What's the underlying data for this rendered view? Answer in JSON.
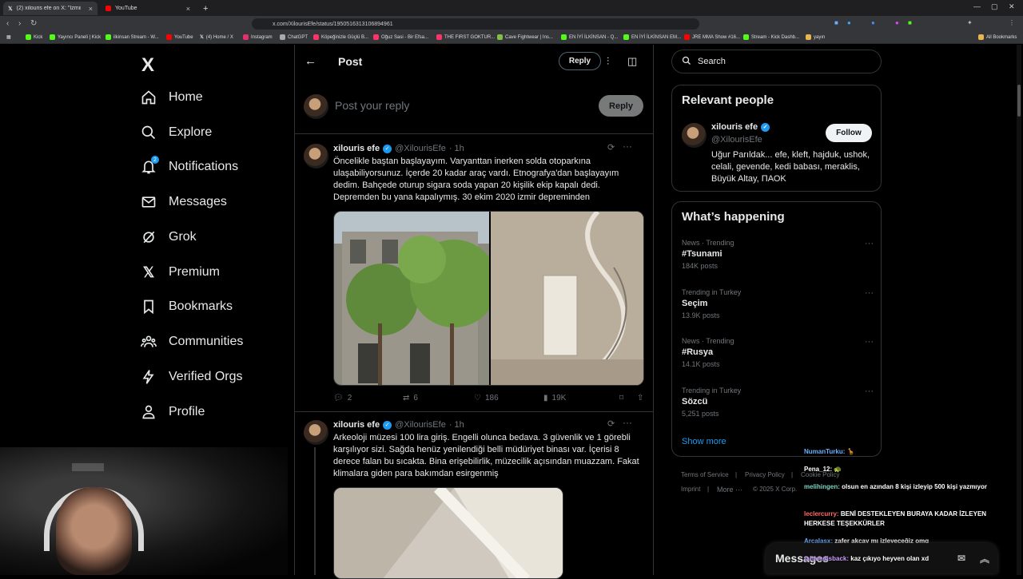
{
  "browser": {
    "tabs": [
      {
        "label": "(2) xilouris efe on X: \"İzmir Ar",
        "active": true
      },
      {
        "label": "YouTube",
        "active": false
      }
    ],
    "new_tab": "+",
    "url": "x.com/XilourisEfe/status/1950516313106894961",
    "bookmarks": [
      "Kick",
      "Yayıncı Paneli | Kick",
      "ilkinsan Stream - W...",
      "YouTube",
      "(4) Home / X",
      "Instagram",
      "ChatGPT",
      "Köpeğinizle Güçlü B...",
      "Oğuz Sasi - Bir Efsa...",
      "THE FIRST GOKTUR...",
      "Cave Fightwear | Ins...",
      "EN İYİ İLKİNSAN - Q...",
      "EN İYİ İLKİNSAN EM...",
      "JRE MMA Show #16...",
      "Stream - Kick Dashb...",
      "yayın"
    ],
    "all_bookmarks": "All Bookmarks"
  },
  "sidebar": {
    "logo": "X",
    "items": [
      {
        "label": "Home",
        "icon": "home-icon"
      },
      {
        "label": "Explore",
        "icon": "search-icon"
      },
      {
        "label": "Notifications",
        "icon": "bell-icon",
        "badge": "2"
      },
      {
        "label": "Messages",
        "icon": "envelope-icon"
      },
      {
        "label": "Grok",
        "icon": "grok-icon"
      },
      {
        "label": "Premium",
        "icon": "x-premium-icon"
      },
      {
        "label": "Bookmarks",
        "icon": "bookmark-icon"
      },
      {
        "label": "Communities",
        "icon": "people-icon"
      },
      {
        "label": "Verified Orgs",
        "icon": "lightning-icon"
      },
      {
        "label": "Profile",
        "icon": "person-icon"
      }
    ]
  },
  "header": {
    "title": "Post",
    "reply_label": "Reply"
  },
  "composer": {
    "placeholder": "Post your reply",
    "button": "Reply"
  },
  "tweets": [
    {
      "name": "xilouris efe",
      "handle": "@XilourisEfe",
      "time": "· 1h",
      "text": "Öncelikle baştan başlayayım. Varyanttan inerken solda otoparkına ulaşabiliyorsunuz. İçerde 20 kadar araç vardı. Etnografya'dan başlayayım dedim. Bahçede oturup sigara soda yapan 20 kişilik ekip kapalı dedi. Depremden bu yana kapalıymış. 30 ekim 2020 izmir depreminden",
      "replies": "2",
      "reposts": "6",
      "likes": "186",
      "views": "19K"
    },
    {
      "name": "xilouris efe",
      "handle": "@XilourisEfe",
      "time": "· 1h",
      "text": "Arkeoloji müzesi 100 lira giriş. Engelli olunca bedava. 3 güvenlik ve 1 görebli karşılıyor sizi. Sağda henüz yenilendiği belli müdüriyet binası var. İçerisi 8 derece falan bu sıcakta. Bina erişebilirlik, müzecilik açısından muazzam. Fakat klimalara giden para bakımdan esirgenmiş"
    }
  ],
  "right": {
    "search_label": "Search",
    "relevant": {
      "title": "Relevant people",
      "name": "xilouris efe",
      "handle": "@XilourisEfe",
      "follow": "Follow",
      "bio": "Uğur Parıldak... efe, kleft, hajduk, ushok, celali, gevende, kedi babası, meraklis, Büyük Altay, ΠΑΟΚ"
    },
    "happening": {
      "title": "What’s happening",
      "trends": [
        {
          "context": "News · Trending",
          "title": "#Tsunami",
          "posts": "184K posts"
        },
        {
          "context": "Trending in Turkey",
          "title": "Seçim",
          "posts": "13.9K posts"
        },
        {
          "context": "News · Trending",
          "title": "#Rusya",
          "posts": "14.1K posts"
        },
        {
          "context": "Trending in Turkey",
          "title": "Sözcü",
          "posts": "5,251 posts"
        }
      ],
      "show_more": "Show more"
    },
    "footer": {
      "terms": "Terms of Service",
      "privacy": "Privacy Policy",
      "cookie": "Cookie Policy",
      "imprint": "Imprint",
      "more": "More ···",
      "copyright": "© 2025 X Corp."
    }
  },
  "chat": [
    {
      "user": "NumanTurku:",
      "msg": "",
      "color": "#6ab0ff"
    },
    {
      "user": "Pena_12:",
      "msg": "",
      "color": "#ffffff"
    },
    {
      "user": "melihingen:",
      "msg": "olsun en azından 8 kişi izleyip 500 kişi yazmıyor",
      "color": "#7fd6c2"
    },
    {
      "user": "leclercurry:",
      "msg": "BENİ DESTEKLEYEN BURAYA KADAR İZLEYEN HERKESE TEŞEKKÜRLER",
      "color": "#ff6b6b"
    },
    {
      "user": "Arcalasx:",
      "msg": "zafer akçay mı izleyeceğiz omg",
      "color": "#6ab0ff"
    },
    {
      "user": "tahamdisback:",
      "msg": "kaz çıkıyo heyven olan xd",
      "color": "#c99cff"
    }
  ],
  "messages_bar": "Messages",
  "colors": {
    "accent": "#1d9bf0",
    "border": "#2f3336",
    "muted": "#71767b"
  }
}
